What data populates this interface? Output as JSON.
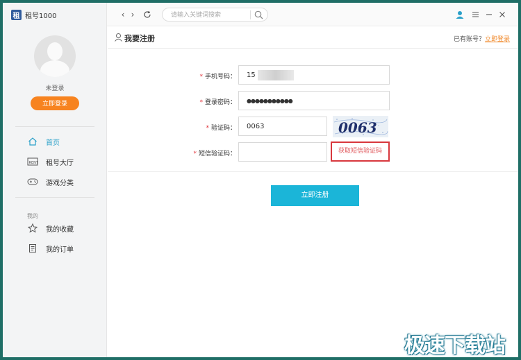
{
  "app": {
    "logo_glyph": "租",
    "name": "租号1000"
  },
  "sidebar": {
    "login_status": "未登录",
    "login_button": "立即登录",
    "nav": [
      {
        "label": "首页",
        "icon": "home-icon",
        "active": true
      },
      {
        "label": "租号大厅",
        "icon": "rent-icon",
        "active": false
      },
      {
        "label": "游戏分类",
        "icon": "gamepad-icon",
        "active": false
      }
    ],
    "section_label": "我的",
    "mine": [
      {
        "label": "我的收藏",
        "icon": "star-icon"
      },
      {
        "label": "我的订单",
        "icon": "order-icon"
      }
    ]
  },
  "topbar": {
    "back": "‹",
    "forward": "›",
    "search_placeholder": "请输入关键词搜索"
  },
  "page": {
    "title": "我要注册",
    "has_account": "已有账号？",
    "login_link": "立即登录"
  },
  "form": {
    "phone_label": "手机号码：",
    "phone_value": "15",
    "password_label": "登录密码：",
    "password_value": "●●●●●●●●●●●",
    "captcha_label": "验证码：",
    "captcha_value": "0063",
    "captcha_image_text": "0063",
    "sms_label": "短信验证码：",
    "sms_value": "",
    "sms_button": "获取短信验证码",
    "required_mark": "*",
    "submit_button": "立即注册"
  },
  "watermark": "极速下载站",
  "colors": {
    "accent": "#1bb5d8",
    "orange": "#f7831f",
    "highlight_red": "#d8373d",
    "active_nav": "#2aa0c9"
  }
}
